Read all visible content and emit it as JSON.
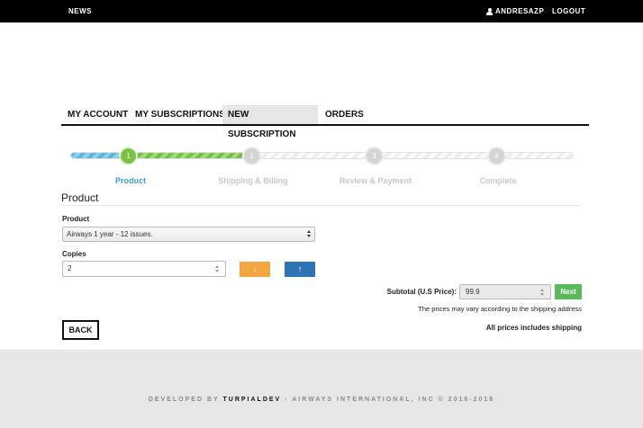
{
  "topbar": {
    "news": "NEWS",
    "username": "ANDRESAZP",
    "logout": "LOGOUT"
  },
  "tabs": [
    {
      "label": "MY ACCOUNT",
      "active": false
    },
    {
      "label": "MY SUBSCRIPTIONS",
      "active": false
    },
    {
      "label": "NEW SUBSCRIPTION",
      "active": true
    },
    {
      "label": "ORDERS",
      "active": false
    }
  ],
  "wizard": {
    "progress_percent": 34,
    "colors": {
      "done": "#5bb5db",
      "active": "#74c043",
      "pending": "#d4d4d4",
      "label_active": "#3b9fd6"
    },
    "steps": [
      {
        "number": "1",
        "label": "Product",
        "active": true
      },
      {
        "number": "2",
        "label": "Shipping & Billing",
        "active": false
      },
      {
        "number": "3",
        "label": "Review & Payment",
        "active": false
      },
      {
        "number": "4",
        "label": "Complete",
        "active": false
      }
    ]
  },
  "form": {
    "section_title": "Product",
    "product_label": "Product",
    "product_value": "Airways 1 year - 12 issues.",
    "copies_label": "Copies",
    "copies_value": "2",
    "decrease_icon": "arrow-down-icon",
    "increase_icon": "arrow-up-icon",
    "subtotal_label": "Subtotal (U.S Price):",
    "subtotal_value": "99.9",
    "next_label": "Next",
    "prices_note": "The prices may vary according to the shipping address",
    "shipping_note": "All prices includes shipping",
    "back_label": "BACK"
  },
  "footer": {
    "prefix": "DEVELOPED BY ",
    "brand": "TURPIALDEV",
    "suffix": " - AIRWAYS INTERNATIONAL, INC © 2016-2018"
  }
}
